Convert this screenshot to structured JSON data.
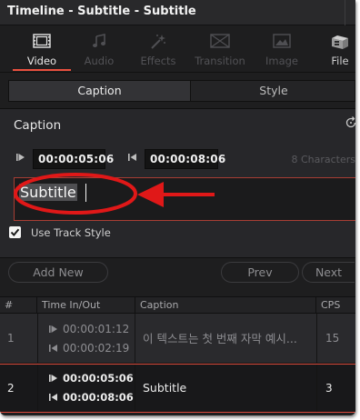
{
  "window": {
    "title": "Timeline - Subtitle - Subtitle"
  },
  "inspector_tabs": [
    {
      "label": "Video",
      "icon": "film-strip-icon",
      "state": "active"
    },
    {
      "label": "Audio",
      "icon": "music-note-icon",
      "state": "disabled"
    },
    {
      "label": "Effects",
      "icon": "magic-wand-icon",
      "state": "disabled"
    },
    {
      "label": "Transition",
      "icon": "transition-icon",
      "state": "disabled"
    },
    {
      "label": "Image",
      "icon": "image-icon",
      "state": "disabled"
    },
    {
      "label": "File",
      "icon": "file-cabinet-icon",
      "state": "enabled"
    }
  ],
  "segment": {
    "caption_label": "Caption",
    "style_label": "Style",
    "selected": "Caption"
  },
  "caption_section": {
    "title": "Caption",
    "reset_icon": "reset-icon",
    "in_timecode": "00:00:05:06",
    "out_timecode": "00:00:08:06",
    "char_count": "8 Characters",
    "caption_text": "Subtitle",
    "use_track_style": {
      "label": "Use Track Style",
      "checked": true
    }
  },
  "actions": {
    "add_new": "Add New",
    "prev": "Prev",
    "next": "Next"
  },
  "table": {
    "headers": [
      "#",
      "Time In/Out",
      "Caption",
      "CPS"
    ],
    "rows": [
      {
        "num": "1",
        "time_in": "00:00:01:12",
        "time_out": "00:00:02:19",
        "caption": "이 텍스트는 첫 번째 자막 예시...",
        "cps": "15",
        "selected": false
      },
      {
        "num": "2",
        "time_in": "00:00:05:06",
        "time_out": "00:00:08:06",
        "caption": "Subtitle",
        "cps": "3",
        "selected": true
      }
    ]
  },
  "colors": {
    "accent": "#e9503f",
    "panel_bg": "#1e1e1f",
    "annotation_red": "#e01818"
  }
}
